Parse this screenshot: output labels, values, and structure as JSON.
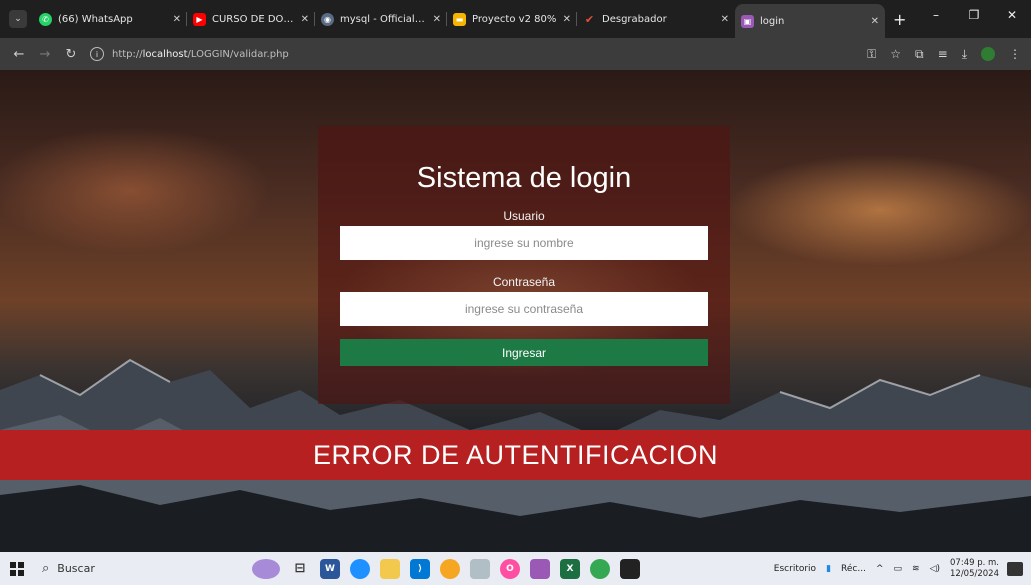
{
  "browser": {
    "tab_menu_icon": "chevron-down-icon",
    "tabs": [
      {
        "title": "(66) WhatsApp",
        "favicon_color": "#25d366",
        "favicon": "whatsapp-icon",
        "active": false
      },
      {
        "title": "CURSO DE DOCKER",
        "favicon_color": "#ff0000",
        "favicon": "youtube-icon",
        "active": false
      },
      {
        "title": "mysql - Official Imag",
        "favicon_color": "#5a6b84",
        "favicon": "docker-icon",
        "active": false
      },
      {
        "title": "Proyecto v2 80%",
        "favicon_color": "#f4b400",
        "favicon": "slides-icon",
        "active": false
      },
      {
        "title": "Desgrabador",
        "favicon_color": "#c0392b",
        "favicon": "check-icon",
        "active": false
      },
      {
        "title": "login",
        "favicon_color": "#9b59b6",
        "favicon": "page-icon",
        "active": true
      }
    ],
    "new_tab": "+",
    "window_controls": {
      "minimize": "–",
      "restore": "❐",
      "close": "✕"
    },
    "url_prefix": "http://",
    "url_host": "localhost",
    "url_path": "/LOGGIN/validar.php"
  },
  "login": {
    "title": "Sistema de login",
    "user_label": "Usuario",
    "user_placeholder": "ingrese su nombre",
    "password_label": "Contraseña",
    "password_placeholder": "ingrese su contraseña",
    "submit_label": "Ingresar"
  },
  "error": {
    "message": "ERROR DE AUTENTIFICACION",
    "color": "#b62020"
  },
  "taskbar": {
    "search_label": "Buscar",
    "desktop_label": "Escritorio",
    "weather_label": "Réc...",
    "time": "07:49 p. m.",
    "date": "12/05/2024"
  }
}
